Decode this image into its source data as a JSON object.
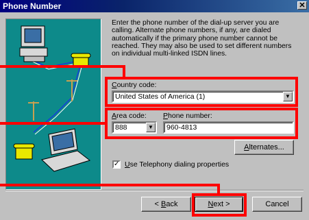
{
  "window": {
    "title": "Phone Number",
    "close_glyph": "✕"
  },
  "description": "Enter the phone number of the dial-up server you are calling.  Alternate phone numbers, if any, are dialed automatically if the primary phone number cannot be reached.  They may also be used to set different numbers on individual multi-linked ISDN lines.",
  "country": {
    "label_u": "C",
    "label_rest": "ountry code:",
    "value": "United States of America (1)"
  },
  "area": {
    "label_u": "A",
    "label_rest": "rea code:",
    "value": "888"
  },
  "phone": {
    "label_u": "P",
    "label_rest": "hone number:",
    "value": "960-4813"
  },
  "alternates": {
    "label_u": "A",
    "label_rest": "lternates..."
  },
  "telephony": {
    "label_u": "U",
    "label_rest": "se Telephony dialing properties",
    "checked": true
  },
  "buttons": {
    "back_prefix": "< ",
    "back_u": "B",
    "back_rest": "ack",
    "next_u": "N",
    "next_rest": "ext >",
    "cancel": "Cancel"
  },
  "icons": [
    "close-icon",
    "computer-icon",
    "telephone-icon",
    "laptop-icon",
    "dropdown-arrow-icon"
  ],
  "colors": {
    "highlight": "#ff0000",
    "title_bar": "#000080",
    "art_bg": "#0d8a8a"
  }
}
